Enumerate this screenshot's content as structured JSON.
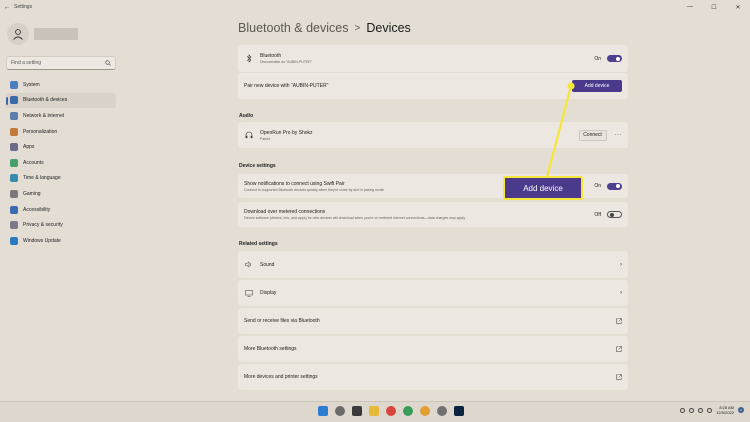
{
  "window": {
    "title": "Settings",
    "back_icon": "back-arrow-icon",
    "controls": [
      "minimize-icon",
      "maximize-icon",
      "close-icon"
    ]
  },
  "search": {
    "placeholder": "Find a setting"
  },
  "sidebar": {
    "items": [
      {
        "label": "System",
        "color": "#4a7fc0",
        "active": false
      },
      {
        "label": "Bluetooth & devices",
        "color": "#3a6aa8",
        "active": true
      },
      {
        "label": "Network & internet",
        "color": "#5b7fa8",
        "active": false
      },
      {
        "label": "Personalization",
        "color": "#c07a3a",
        "active": false
      },
      {
        "label": "Apps",
        "color": "#6a6a8a",
        "active": false
      },
      {
        "label": "Accounts",
        "color": "#4aa06a",
        "active": false
      },
      {
        "label": "Time & language",
        "color": "#3a8ab0",
        "active": false
      },
      {
        "label": "Gaming",
        "color": "#7a7a7a",
        "active": false
      },
      {
        "label": "Accessibility",
        "color": "#3a6ab0",
        "active": false
      },
      {
        "label": "Privacy & security",
        "color": "#7a7a8a",
        "active": false
      },
      {
        "label": "Windows Update",
        "color": "#2a7ac0",
        "active": false
      }
    ]
  },
  "header": {
    "crumb": "Bluetooth & devices",
    "separator": ">",
    "current": "Devices"
  },
  "bluetooth": {
    "title": "Bluetooth",
    "subtitle": "Discoverable as \"AUBIN-PUTER\"",
    "state": "On"
  },
  "pair": {
    "label": "Pair new device with \"AUBIN-PUTER\"",
    "button": "Add device"
  },
  "audio": {
    "heading": "Audio",
    "device": {
      "name": "OpenRun Pro by Shokz",
      "status": "Paired",
      "button": "Connect",
      "more": "···"
    }
  },
  "device_settings": {
    "heading": "Device settings",
    "swift_pair": {
      "title": "Show notifications to connect using Swift Pair",
      "desc": "Connect to supported Bluetooth devices quickly when they're close by and in pairing mode",
      "state": "On"
    },
    "metered": {
      "title": "Download over metered connections",
      "desc": "Device software (drivers, info, and apps) for new devices will download when you're on metered internet connections—data charges may apply",
      "state": "Off"
    }
  },
  "related": {
    "heading": "Related settings",
    "items": [
      {
        "label": "Sound",
        "icon": "speaker-icon",
        "arrow": "›"
      },
      {
        "label": "Display",
        "icon": "monitor-icon",
        "arrow": "›"
      },
      {
        "label": "Send or receive files via Bluetooth",
        "icon": "",
        "arrow": "external"
      },
      {
        "label": "More Bluetooth settings",
        "icon": "",
        "arrow": "external"
      },
      {
        "label": "More devices and printer settings",
        "icon": "",
        "arrow": "external"
      }
    ]
  },
  "callout": {
    "label": "Add device",
    "color": "#f5e63a"
  },
  "taskbar": {
    "time": "8:28 AM",
    "date": "12/5/2022",
    "badge": "2",
    "apps": [
      "start-icon",
      "search-icon",
      "camera-app-icon",
      "file-explorer-icon",
      "chrome-icon",
      "chrome-dev-icon",
      "chrome-beta-icon",
      "settings-app-icon",
      "photoshop-icon"
    ]
  }
}
